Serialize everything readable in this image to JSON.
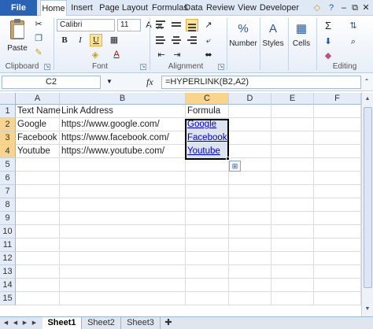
{
  "menu": {
    "file": "File",
    "tabs": [
      "Home",
      "Insert",
      "Page Layout",
      "Formulas",
      "Data",
      "Review",
      "View",
      "Developer"
    ],
    "active_tab": "Home"
  },
  "ribbon": {
    "clipboard": {
      "paste_label": "Paste",
      "group_label": "Clipboard"
    },
    "font": {
      "font_name": "Calibri",
      "font_size": "11",
      "bold": "B",
      "italic": "I",
      "underline": "U",
      "grow": "A",
      "shrink": "A",
      "color_letter": "A",
      "group_label": "Font"
    },
    "alignment": {
      "group_label": "Alignment"
    },
    "number": {
      "label": "Number",
      "icon_text": "%"
    },
    "styles": {
      "label": "Styles"
    },
    "cells": {
      "label": "Cells"
    },
    "editing": {
      "label": "Editing",
      "sum_icon": "Σ"
    }
  },
  "formula_bar": {
    "name_box": "C2",
    "fx": "fx",
    "formula": "=HYPERLINK(B2,A2)"
  },
  "grid": {
    "columns": [
      "A",
      "B",
      "C",
      "D",
      "E",
      "F"
    ],
    "selected_column": "C",
    "rows": [
      "1",
      "2",
      "3",
      "4",
      "5",
      "6",
      "7",
      "8",
      "9",
      "10",
      "11",
      "12",
      "13",
      "14",
      "15",
      "16"
    ],
    "data": [
      [
        "Text Name",
        "Link Address",
        "Formula"
      ],
      [
        "Google",
        "https://www.google.com/",
        "Google"
      ],
      [
        "Facebook",
        "https://www.facebook.com/",
        "Facebook"
      ],
      [
        "Youtube",
        "https://www.youtube.com/",
        "Youtube"
      ]
    ]
  },
  "sheets": {
    "tabs": [
      "Sheet1",
      "Sheet2",
      "Sheet3"
    ],
    "active": "Sheet1"
  },
  "colors": {
    "file_tab": "#2a63b6",
    "selection_header": "#f8d48c",
    "hyperlink": "#0000cc"
  }
}
